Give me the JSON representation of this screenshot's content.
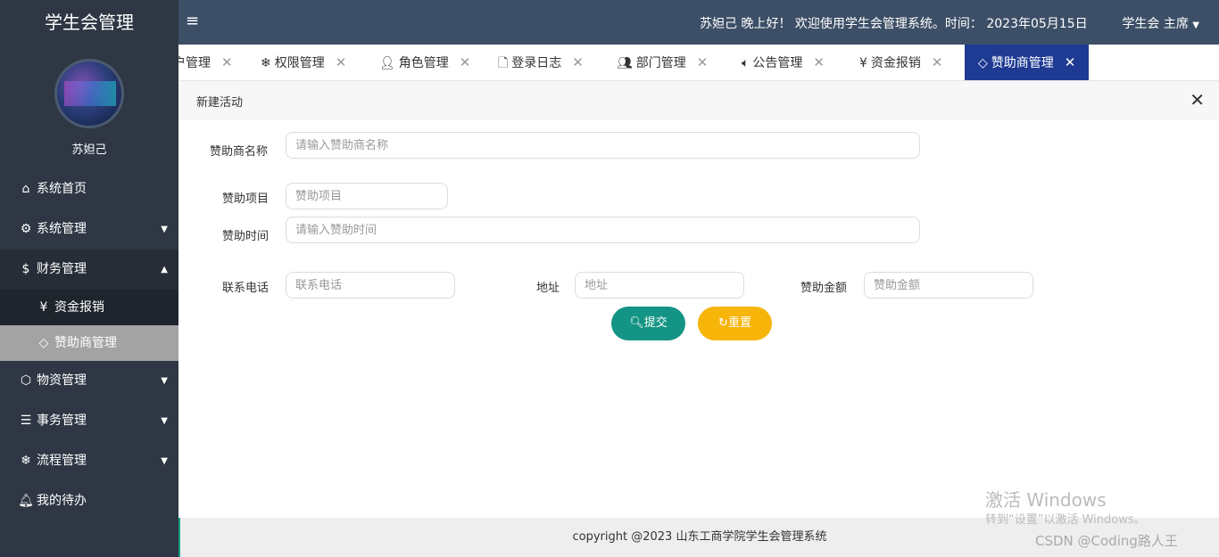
{
  "sidebar": {
    "brand": "学生会管理",
    "username": "苏妲己",
    "menu": [
      {
        "label": "系统首页",
        "icon": "home-icon"
      },
      {
        "label": "系统管理",
        "icon": "gear-icon"
      },
      {
        "label": "财务管理",
        "icon": "dollar-icon"
      },
      {
        "label": "物资管理",
        "icon": "box-icon"
      },
      {
        "label": "事务管理",
        "icon": "sliders-icon"
      },
      {
        "label": "流程管理",
        "icon": "snowflake-icon"
      },
      {
        "label": "我的待办",
        "icon": "bell-icon"
      }
    ],
    "submenu": [
      {
        "label": "资金报销",
        "icon": "yen-icon"
      },
      {
        "label": "赞助商管理",
        "icon": "diamond-icon"
      }
    ]
  },
  "header": {
    "menu_icon": "≡",
    "welcome": "苏妲己 晚上好！ 欢迎使用学生会管理系统。时间： 2023年05月15日",
    "role": "学生会 主席"
  },
  "tabs": [
    {
      "label": "户管理",
      "icon": "user-icon"
    },
    {
      "label": "权限管理",
      "icon": "snowflake-icon"
    },
    {
      "label": "角色管理",
      "icon": "person-icon"
    },
    {
      "label": "登录日志",
      "icon": "file-icon"
    },
    {
      "label": "部门管理",
      "icon": "users-icon"
    },
    {
      "label": "公告管理",
      "icon": "volume-icon"
    },
    {
      "label": "资金报销",
      "icon": "yen-icon"
    },
    {
      "label": "赞助商管理",
      "icon": "diamond-icon"
    }
  ],
  "panel": {
    "title": "新建活动"
  },
  "form": {
    "sponsor_name": {
      "label": "赞助商名称",
      "placeholder": "请输入赞助商名称"
    },
    "project": {
      "label": "赞助项目",
      "placeholder": "赞助项目"
    },
    "time": {
      "label": "赞助时间",
      "placeholder": "请输入赞助时间"
    },
    "phone": {
      "label": "联系电话",
      "placeholder": "联系电话"
    },
    "address": {
      "label": "地址",
      "placeholder": "地址"
    },
    "amount": {
      "label": "赞助金额",
      "placeholder": "赞助金额"
    },
    "submit": "提交",
    "reset": "重置"
  },
  "footer": {
    "text": "copyright @2023 山东工商学院学生会管理系统"
  },
  "watermark": {
    "line1": "激活 Windows",
    "line2": "转到“设置”以激活 Windows。",
    "csdn": "CSDN @Coding路人王"
  },
  "colors": {
    "sidebar_bg": "#2f3744",
    "header_bg": "#3d4f67",
    "active_tab": "#1f3a93",
    "submit": "#149484",
    "reset": "#f7b50a"
  }
}
